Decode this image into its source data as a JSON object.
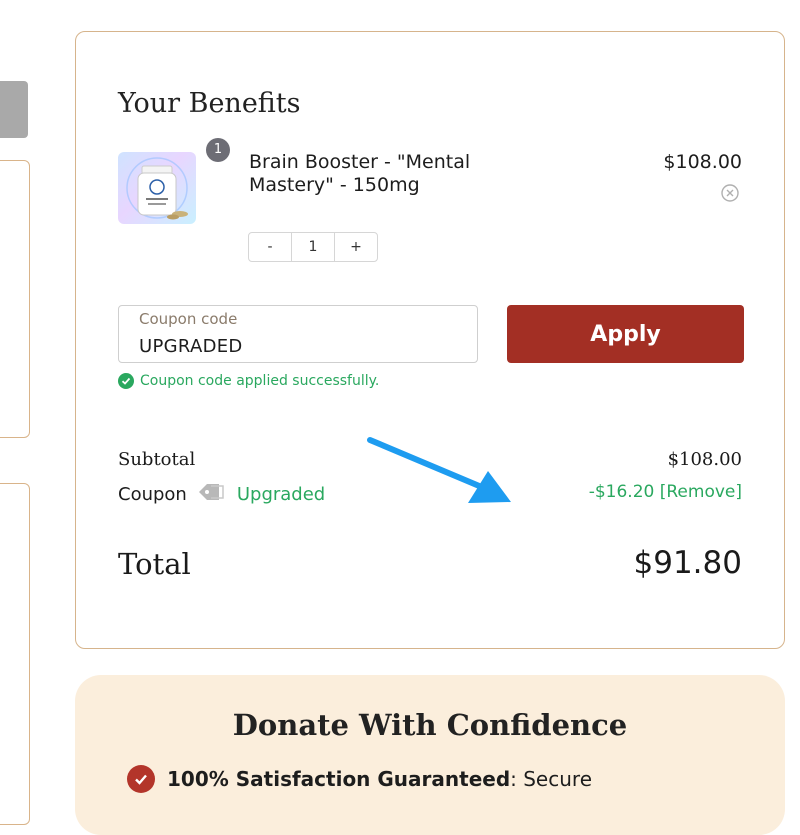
{
  "summary": {
    "title": "Your Benefits",
    "item": {
      "quantity_badge": "1",
      "name": "Brain Booster - \"Mental Mastery\" - 150mg",
      "price": "$108.00",
      "remove_icon": "close-circle-icon",
      "stepper": {
        "minus": "-",
        "value": "1",
        "plus": "+"
      }
    },
    "coupon": {
      "label": "Coupon code",
      "value": "UPGRADED",
      "apply_label": "Apply",
      "success_message": "Coupon code applied successfully."
    },
    "totals": {
      "subtotal_label": "Subtotal",
      "subtotal_value": "$108.00",
      "coupon_label": "Coupon",
      "coupon_name": "Upgraded",
      "coupon_discount": "-$16.20 [Remove]",
      "total_label": "Total",
      "total_value": "$91.80"
    }
  },
  "donate": {
    "title": "Donate With Confidence",
    "line_bold": "100% Satisfaction Guaranteed",
    "line_rest": ": Secure"
  },
  "colors": {
    "accent": "#a32f24",
    "success": "#2aa85f",
    "card_border": "#d6b48c",
    "donate_bg": "#fbeedc",
    "annotation_arrow": "#1e9cf0"
  }
}
